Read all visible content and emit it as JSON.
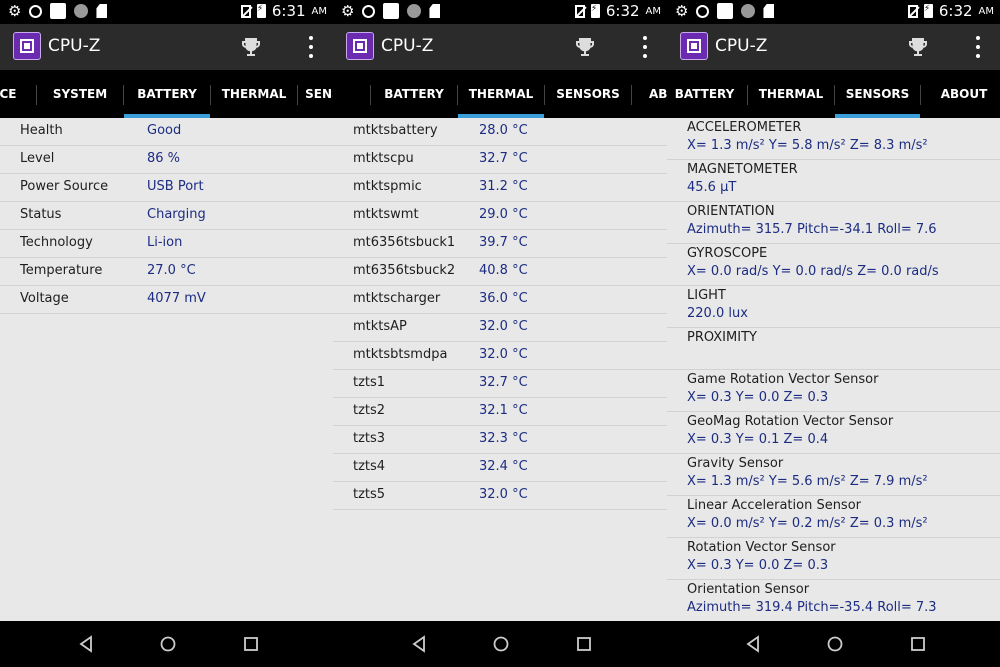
{
  "app": {
    "title": "CPU-Z"
  },
  "screens": [
    {
      "time": "6:31",
      "ampm": "AM",
      "tabs": [
        "CE",
        "SYSTEM",
        "BATTERY",
        "THERMAL",
        "SENSO"
      ],
      "active_tab": "BATTERY",
      "rows": [
        {
          "key": "Health",
          "value": "Good"
        },
        {
          "key": "Level",
          "value": "86 %"
        },
        {
          "key": "Power Source",
          "value": "USB Port"
        },
        {
          "key": "Status",
          "value": "Charging"
        },
        {
          "key": "Technology",
          "value": "Li-ion"
        },
        {
          "key": "Temperature",
          "value": "27.0 °C"
        },
        {
          "key": "Voltage",
          "value": "4077 mV"
        }
      ]
    },
    {
      "time": "6:32",
      "ampm": "AM",
      "tabs": [
        "BATTERY",
        "THERMAL",
        "SENSORS",
        "AB"
      ],
      "active_tab": "THERMAL",
      "rows": [
        {
          "key": "mtktsbattery",
          "value": "28.0 °C"
        },
        {
          "key": "mtktscpu",
          "value": "32.7 °C"
        },
        {
          "key": "mtktspmic",
          "value": "31.2 °C"
        },
        {
          "key": "mtktswmt",
          "value": "29.0 °C"
        },
        {
          "key": "mt6356tsbuck1",
          "value": "39.7 °C"
        },
        {
          "key": "mt6356tsbuck2",
          "value": "40.8 °C"
        },
        {
          "key": "mtktscharger",
          "value": "36.0 °C"
        },
        {
          "key": "mtktsAP",
          "value": "32.0 °C"
        },
        {
          "key": "mtktsbtsmdpa",
          "value": "32.0 °C"
        },
        {
          "key": "tzts1",
          "value": "32.7 °C"
        },
        {
          "key": "tzts2",
          "value": "32.1 °C"
        },
        {
          "key": "tzts3",
          "value": "32.3 °C"
        },
        {
          "key": "tzts4",
          "value": "32.4 °C"
        },
        {
          "key": "tzts5",
          "value": "32.0 °C"
        }
      ]
    },
    {
      "time": "6:32",
      "ampm": "AM",
      "tabs": [
        "BATTERY",
        "THERMAL",
        "SENSORS",
        "ABOUT"
      ],
      "active_tab": "SENSORS",
      "sensors": [
        {
          "name": "ACCELEROMETER",
          "data": "X= 1.3 m/s²   Y= 5.8 m/s²   Z= 8.3 m/s²"
        },
        {
          "name": "MAGNETOMETER",
          "data": "45.6 μT"
        },
        {
          "name": "ORIENTATION",
          "data": "Azimuth= 315.7   Pitch=-34.1   Roll= 7.6"
        },
        {
          "name": "GYROSCOPE",
          "data": "X= 0.0 rad/s   Y= 0.0 rad/s   Z= 0.0 rad/s"
        },
        {
          "name": "LIGHT",
          "data": "220.0 lux"
        },
        {
          "name": "PROXIMITY",
          "data": ""
        },
        {
          "name": "Game Rotation Vector Sensor",
          "data": "X= 0.3   Y= 0.0   Z= 0.3"
        },
        {
          "name": "GeoMag Rotation Vector Sensor",
          "data": "X= 0.3   Y= 0.1   Z= 0.4"
        },
        {
          "name": "Gravity Sensor",
          "data": "X= 1.3 m/s²   Y= 5.6 m/s²   Z= 7.9 m/s²"
        },
        {
          "name": "Linear Acceleration Sensor",
          "data": "X= 0.0 m/s²   Y= 0.2 m/s²   Z= 0.3 m/s²"
        },
        {
          "name": "Rotation Vector Sensor",
          "data": "X= 0.3   Y= 0.0   Z= 0.3"
        },
        {
          "name": "Orientation Sensor",
          "data": "Azimuth= 319.4   Pitch=-35.4   Roll= 7.3"
        }
      ]
    }
  ],
  "icons": {
    "statusbar": [
      "gear-icon",
      "data-saver-icon",
      "notification-square-icon",
      "dot-icon",
      "sim-icon",
      "no-sim-icon",
      "battery-charging-icon"
    ],
    "appbar": [
      "cpu-z-logo-icon",
      "trophy-icon",
      "more-vert-icon"
    ],
    "navbar": [
      "back-icon",
      "home-icon",
      "recents-icon"
    ]
  },
  "colors": {
    "accent": "#3a9fd9",
    "value_text": "#1c2c82",
    "appbar_bg": "#2b2b2b"
  }
}
